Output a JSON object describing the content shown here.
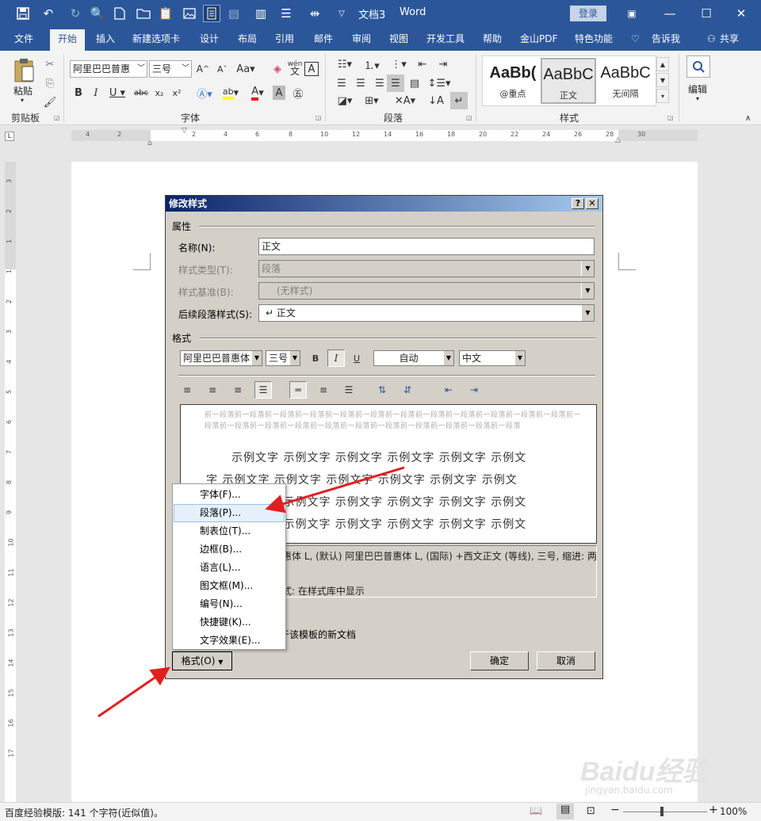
{
  "titlebar": {
    "doc_title": "文档3",
    "app_name": "Word",
    "login_label": "登录"
  },
  "tabs": [
    "文件",
    "开始",
    "插入",
    "新建选项卡",
    "设计",
    "布局",
    "引用",
    "邮件",
    "审阅",
    "视图",
    "开发工具",
    "帮助",
    "金山PDF",
    "特色功能",
    "告诉我",
    "共享"
  ],
  "ribbon": {
    "clipboard": {
      "paste_label": "粘贴",
      "group_label": "剪贴板"
    },
    "font": {
      "font_name": "阿里巴巴普惠",
      "font_size": "三号",
      "group_label": "字体",
      "pinyin_label": "wén"
    },
    "paragraph": {
      "group_label": "段落"
    },
    "styles": {
      "group_label": "样式",
      "items": [
        {
          "preview": "AaBb(",
          "name": "@重点"
        },
        {
          "preview": "AaBbC",
          "name": "正文"
        },
        {
          "preview": "AaBbC",
          "name": "无间隔"
        }
      ]
    },
    "editing": {
      "label": "编辑"
    }
  },
  "ruler": {
    "h_ticks": [
      "4",
      "2",
      "2",
      "4",
      "6",
      "8",
      "10",
      "12",
      "14",
      "16",
      "18",
      "20",
      "22",
      "24",
      "26",
      "28",
      "30"
    ],
    "v_ticks": [
      "3",
      "2",
      "1",
      "1",
      "2",
      "3",
      "4",
      "5",
      "6",
      "7",
      "8",
      "9",
      "10",
      "11",
      "12",
      "13",
      "14",
      "15",
      "16",
      "17"
    ]
  },
  "dialog": {
    "title": "修改样式",
    "section_props": "属性",
    "name_label": "名称(N):",
    "name_value": "正文",
    "type_label": "样式类型(T):",
    "type_value": "段落",
    "base_label": "样式基准(B):",
    "base_value": "(无样式)",
    "next_label": "后续段落样式(S):",
    "next_value": "↵ 正文",
    "section_format": "格式",
    "font_value": "阿里巴巴普惠体",
    "size_value": "三号",
    "color_value": "自动",
    "lang_value": "中文",
    "preview_prev": "前一段落前一段落前一段落前一段落前一段落前一段落前一段落前一段落前一段落前一段落前一段落前一段落前一段落前一段落前一段落前一段落前一段落前一段落前一段落前一段落前一段落前一段落前一段落",
    "preview_lines": [
      "示例文字 示例文字 示例文字 示例文字 示例文字 示例文",
      "字 示例文字 示例文字 示例文字 示例文字 示例文字 示例文",
      "示例文字 示例文字 示例文字 示例文字 示例文字 示例文",
      "示例文字 示例文字 示例文字 示例文字 示例文字 示例文"
    ],
    "desc_line1": "惠体 L, (默认) 阿里巴巴普惠体 L, (国际) +西文正文 (等线), 三号, 缩进: 两",
    "desc_line2": "式: 在样式库中显示",
    "template_text": "于该模板的新文档",
    "format_button": "格式(O)",
    "ok_button": "确定",
    "cancel_button": "取消"
  },
  "format_menu": {
    "items": [
      "字体(F)...",
      "段落(P)...",
      "制表位(T)...",
      "边框(B)...",
      "语言(L)...",
      "图文框(M)...",
      "编号(N)...",
      "快捷键(K)...",
      "文字效果(E)..."
    ],
    "highlighted": "段落(P)..."
  },
  "statusbar": {
    "left_text": "百度经验模版: 141 个字符(近似值)。",
    "zoom": "100%"
  },
  "watermark": {
    "brand": "Baidu经验",
    "url": "jingyan.baidu.com"
  },
  "colors": {
    "word_blue": "#2b579a",
    "dialog_grey": "#d4d0c8",
    "arrow_red": "#e02020"
  }
}
